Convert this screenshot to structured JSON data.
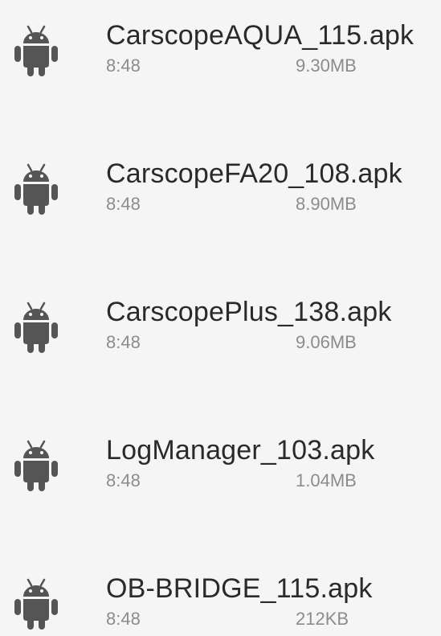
{
  "file_list": {
    "icon": "android-icon",
    "icon_color": "#555555",
    "files": [
      {
        "name": "CarscopeAQUA_115.apk",
        "time": "8:48",
        "size": "9.30MB"
      },
      {
        "name": "CarscopeFA20_108.apk",
        "time": "8:48",
        "size": "8.90MB"
      },
      {
        "name": "CarscopePlus_138.apk",
        "time": "8:48",
        "size": "9.06MB"
      },
      {
        "name": "LogManager_103.apk",
        "time": "8:48",
        "size": "1.04MB"
      },
      {
        "name": "OB-BRIDGE_115.apk",
        "time": "8:48",
        "size": "212KB"
      }
    ]
  }
}
